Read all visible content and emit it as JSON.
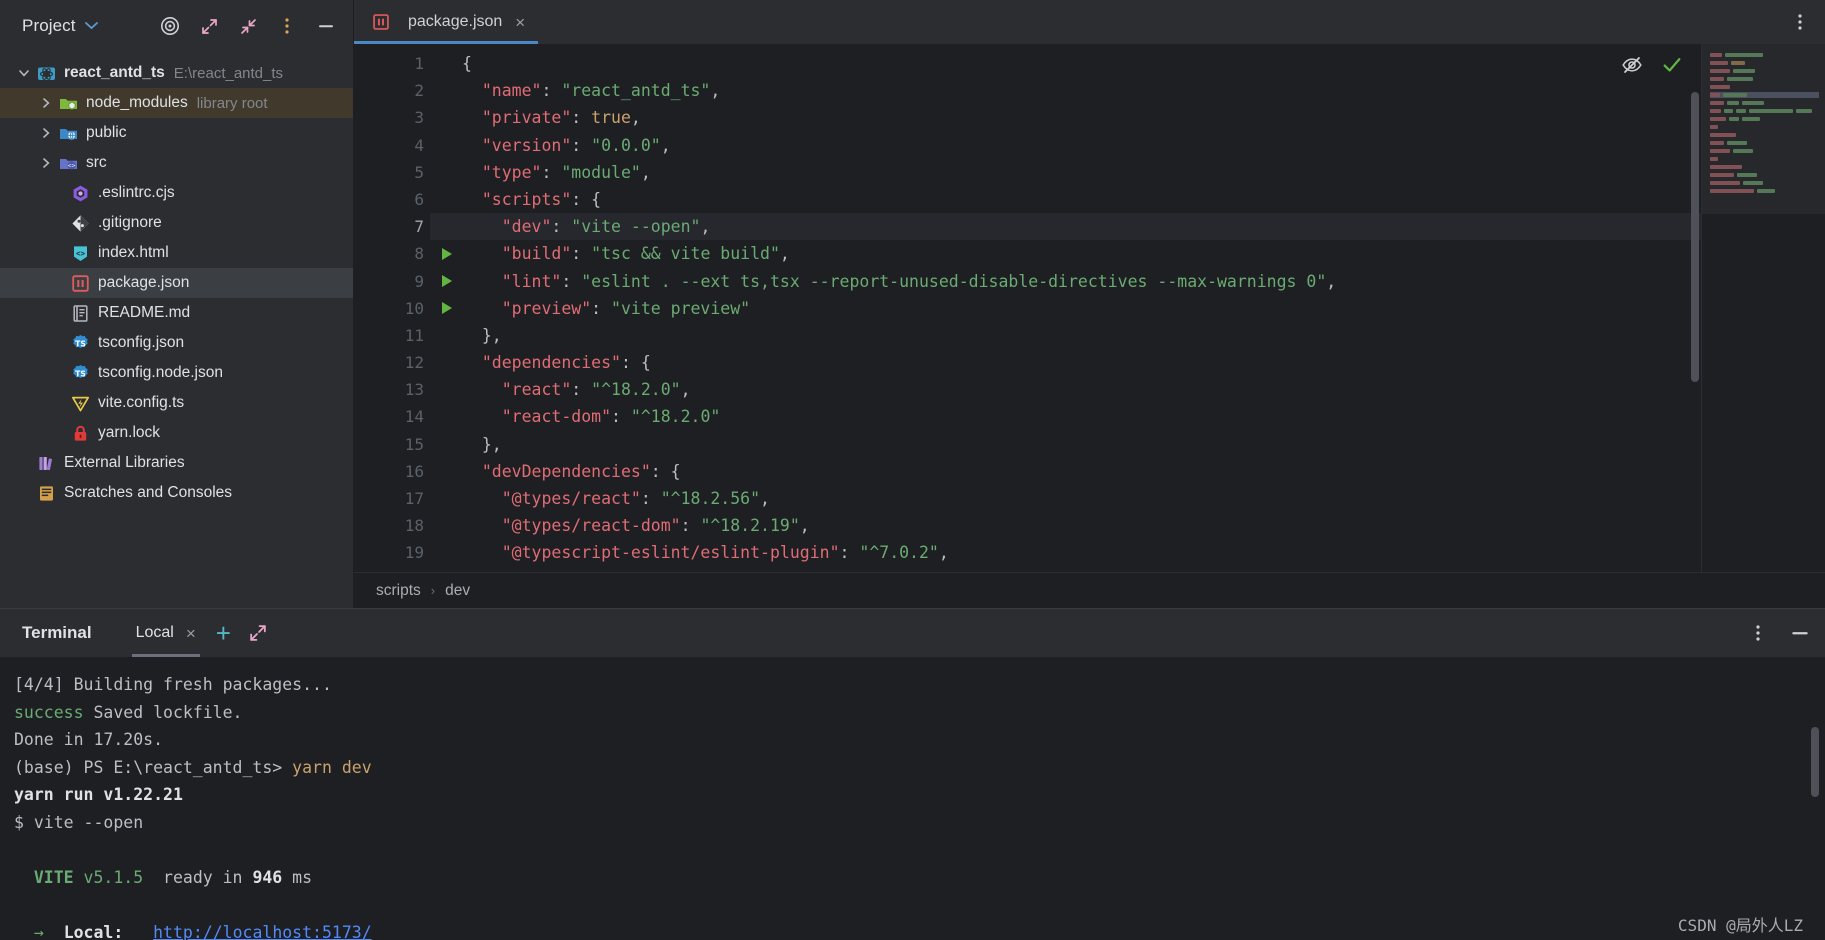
{
  "sidebar": {
    "title": "Project",
    "actions": [
      "target-icon",
      "expand-icon",
      "collapse-icon",
      "more-vertical-icon",
      "minimize-icon"
    ],
    "tree": [
      {
        "label": "react_antd_ts",
        "sub": "E:\\react_antd_ts",
        "icon": "project-module-icon",
        "arrow": "expanded",
        "depth": 0,
        "state": "normal"
      },
      {
        "label": "node_modules",
        "sub": "library root",
        "icon": "node-folder-icon",
        "arrow": "collapsed",
        "depth": 1,
        "state": "highlighted"
      },
      {
        "label": "public",
        "sub": "",
        "icon": "web-folder-icon",
        "arrow": "collapsed",
        "depth": 1,
        "state": "normal"
      },
      {
        "label": "src",
        "sub": "",
        "icon": "source-folder-icon",
        "arrow": "collapsed",
        "depth": 1,
        "state": "normal"
      },
      {
        "label": ".eslintrc.cjs",
        "sub": "",
        "icon": "eslint-icon",
        "arrow": "none",
        "depth": 1,
        "state": "normal"
      },
      {
        "label": ".gitignore",
        "sub": "",
        "icon": "git-icon",
        "arrow": "none",
        "depth": 1,
        "state": "normal"
      },
      {
        "label": "index.html",
        "sub": "",
        "icon": "html-icon",
        "arrow": "none",
        "depth": 1,
        "state": "normal"
      },
      {
        "label": "package.json",
        "sub": "",
        "icon": "npm-icon",
        "arrow": "none",
        "depth": 1,
        "state": "selected"
      },
      {
        "label": "README.md",
        "sub": "",
        "icon": "markdown-icon",
        "arrow": "none",
        "depth": 1,
        "state": "normal"
      },
      {
        "label": "tsconfig.json",
        "sub": "",
        "icon": "typescript-config-icon",
        "arrow": "none",
        "depth": 1,
        "state": "normal"
      },
      {
        "label": "tsconfig.node.json",
        "sub": "",
        "icon": "typescript-config-icon",
        "arrow": "none",
        "depth": 1,
        "state": "normal"
      },
      {
        "label": "vite.config.ts",
        "sub": "",
        "icon": "vite-icon",
        "arrow": "none",
        "depth": 1,
        "state": "normal"
      },
      {
        "label": "yarn.lock",
        "sub": "",
        "icon": "lock-icon",
        "arrow": "none",
        "depth": 1,
        "state": "normal"
      },
      {
        "label": "External Libraries",
        "sub": "",
        "icon": "libraries-icon",
        "arrow": "none",
        "depth": 0,
        "state": "normal"
      },
      {
        "label": "Scratches and Consoles",
        "sub": "",
        "icon": "scratches-icon",
        "arrow": "none",
        "depth": 0,
        "state": "normal"
      }
    ]
  },
  "editor": {
    "tab": {
      "label": "package.json",
      "icon": "npm-icon",
      "close": "×"
    },
    "more_icon": "more-vertical-icon",
    "inspection_icons": [
      "reader-mode-off-icon",
      "no-problems-check-icon"
    ],
    "lines": [
      {
        "n": "1",
        "runnable": false,
        "bulb": false,
        "text": "{"
      },
      {
        "n": "2",
        "runnable": false,
        "bulb": false,
        "text": "  \"name\": \"react_antd_ts\","
      },
      {
        "n": "3",
        "runnable": false,
        "bulb": false,
        "text": "  \"private\": true,"
      },
      {
        "n": "4",
        "runnable": false,
        "bulb": false,
        "text": "  \"version\": \"0.0.0\","
      },
      {
        "n": "5",
        "runnable": false,
        "bulb": false,
        "text": "  \"type\": \"module\","
      },
      {
        "n": "6",
        "runnable": false,
        "bulb": true,
        "text": "  \"scripts\": {"
      },
      {
        "n": "7",
        "runnable": true,
        "bulb": false,
        "text": "    \"dev\": \"vite --open\","
      },
      {
        "n": "8",
        "runnable": true,
        "bulb": false,
        "text": "    \"build\": \"tsc && vite build\","
      },
      {
        "n": "9",
        "runnable": true,
        "bulb": false,
        "text": "    \"lint\": \"eslint . --ext ts,tsx --report-unused-disable-directives --max-warnings 0\","
      },
      {
        "n": "10",
        "runnable": true,
        "bulb": false,
        "text": "    \"preview\": \"vite preview\""
      },
      {
        "n": "11",
        "runnable": false,
        "bulb": false,
        "text": "  },"
      },
      {
        "n": "12",
        "runnable": false,
        "bulb": false,
        "text": "  \"dependencies\": {"
      },
      {
        "n": "13",
        "runnable": false,
        "bulb": false,
        "text": "    \"react\": \"^18.2.0\","
      },
      {
        "n": "14",
        "runnable": false,
        "bulb": false,
        "text": "    \"react-dom\": \"^18.2.0\""
      },
      {
        "n": "15",
        "runnable": false,
        "bulb": false,
        "text": "  },"
      },
      {
        "n": "16",
        "runnable": false,
        "bulb": false,
        "text": "  \"devDependencies\": {"
      },
      {
        "n": "17",
        "runnable": false,
        "bulb": false,
        "text": "    \"@types/react\": \"^18.2.56\","
      },
      {
        "n": "18",
        "runnable": false,
        "bulb": false,
        "text": "    \"@types/react-dom\": \"^18.2.19\","
      },
      {
        "n": "19",
        "runnable": false,
        "bulb": false,
        "text": "    \"@typescript-eslint/eslint-plugin\": \"^7.0.2\","
      }
    ],
    "current_line": "7",
    "breadcrumbs": [
      "scripts",
      "dev"
    ],
    "breadcrumb_separator": "›"
  },
  "terminal": {
    "title": "Terminal",
    "tab": {
      "label": "Local",
      "close": "×"
    },
    "new_tab_icon": "plus-icon",
    "expand_icon": "expand-icon",
    "options_icon": "more-vertical-icon",
    "minimize_icon": "minimize-icon",
    "lines": [
      {
        "parts": [
          {
            "t": "[4/4] Building fresh packages...",
            "c": "plain"
          }
        ]
      },
      {
        "parts": [
          {
            "t": "success",
            "c": "green"
          },
          {
            "t": " Saved lockfile.",
            "c": "plain"
          }
        ]
      },
      {
        "parts": [
          {
            "t": "Done in 17.20s.",
            "c": "plain"
          }
        ]
      },
      {
        "parts": [
          {
            "t": "(base) PS E:\\react_antd_ts> ",
            "c": "plain"
          },
          {
            "t": "yarn dev",
            "c": "yellow"
          }
        ]
      },
      {
        "parts": [
          {
            "t": "yarn run v1.22.21",
            "c": "bold"
          }
        ]
      },
      {
        "parts": [
          {
            "t": "$ vite --open",
            "c": "plain"
          }
        ]
      },
      {
        "parts": [
          {
            "t": "",
            "c": "plain"
          }
        ]
      },
      {
        "parts": [
          {
            "t": "  VITE ",
            "c": "green-bold"
          },
          {
            "t": "v5.1.5",
            "c": "green"
          },
          {
            "t": "  ready in ",
            "c": "plain"
          },
          {
            "t": "946",
            "c": "bold"
          },
          {
            "t": " ms",
            "c": "plain"
          }
        ]
      },
      {
        "parts": [
          {
            "t": "",
            "c": "plain"
          }
        ]
      },
      {
        "parts": [
          {
            "t": "  →",
            "c": "green"
          },
          {
            "t": "  ",
            "c": "plain"
          },
          {
            "t": "Local:",
            "c": "bold"
          },
          {
            "t": "   ",
            "c": "plain"
          },
          {
            "t": "http://localhost:5173/",
            "c": "link"
          }
        ]
      }
    ]
  },
  "watermark": "CSDN @局外人LZ",
  "colors": {
    "background": "#1e1f22",
    "panel": "#2b2d30",
    "selection": "#3b3e43",
    "highlight": "#413a2c",
    "accent_blue": "#4a88c7",
    "string_green": "#6aab73",
    "key_red": "#e06c75",
    "link_blue": "#548af7"
  }
}
